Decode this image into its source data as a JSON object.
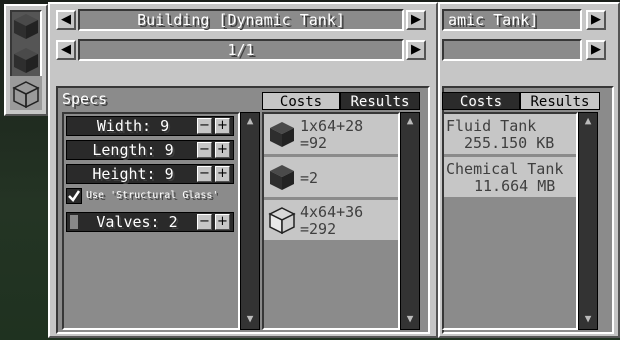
{
  "window": {
    "title": "Building [Dynamic Tank]",
    "page_indicator": "1/1",
    "title_partial": "amic Tank]"
  },
  "specs": {
    "section_label": "Specs",
    "rows": [
      {
        "label": "Width: 9"
      },
      {
        "label": "Length: 9"
      },
      {
        "label": "Height: 9"
      }
    ],
    "structural_glass_checkbox": {
      "label": "Use 'Structural Glass'",
      "checked": true
    },
    "valves": {
      "label": "Valves: 2"
    }
  },
  "tabs": {
    "costs": "Costs",
    "results": "Results"
  },
  "costs": [
    {
      "icon": "dynamic-tank-block-icon",
      "line1": "1x64+28",
      "line2": "=92"
    },
    {
      "icon": "dynamic-valve-block-icon",
      "line1": "=2",
      "line2": ""
    },
    {
      "icon": "structural-glass-block-icon",
      "line1": "4x64+36",
      "line2": "=292"
    }
  ],
  "results": [
    {
      "name": "Fluid Tank",
      "value": "255.150 KB"
    },
    {
      "name": "Chemical Tank",
      "value": "11.664 MB"
    }
  ],
  "sidebar_icons": [
    "dynamic-tank-icon",
    "dynamic-valve-icon",
    "structural-glass-icon"
  ],
  "buttons": {
    "prev": "◀",
    "next": "▶",
    "minus": "−",
    "plus": "+",
    "up": "▲",
    "down": "▼"
  },
  "colors": {
    "panel": "#c6c6c6",
    "inset": "#8b8b8b",
    "dark_row": "#2a2a2a"
  }
}
